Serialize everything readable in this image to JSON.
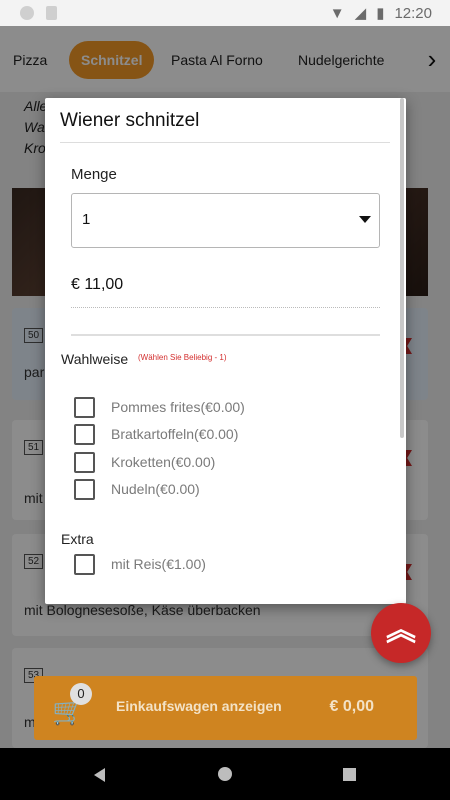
{
  "status_bar": {
    "time": "12:20"
  },
  "categories": {
    "items": [
      "Pizza",
      "Schnitzel",
      "Pasta Al Forno",
      "Nudelgerichte",
      "1"
    ],
    "active": "Schnitzel"
  },
  "background": {
    "top_lines": [
      "Alle",
      "Wa",
      "Kro"
    ],
    "cards": [
      {
        "badge": "50",
        "desc": "par"
      },
      {
        "badge": "51",
        "desc": "mit"
      },
      {
        "badge": "52",
        "desc": "mit Bolognesesoße, Käse überbacken"
      },
      {
        "badge": "53",
        "desc": "m"
      }
    ]
  },
  "dialog": {
    "title": "Wiener schnitzel",
    "quantity_label": "Menge",
    "quantity_value": "1",
    "price": "€ 11,00",
    "options_label": "Wahlweise",
    "options_note": "(Wählen Sie Beliebig - 1)",
    "options": [
      "Pommes frites(€0.00)",
      "Bratkartoffeln(€0.00)",
      "Kroketten(€0.00)",
      "Nudeln(€0.00)"
    ],
    "extra_label": "Extra",
    "extras": [
      "mit Reis(€1.00)"
    ]
  },
  "cart": {
    "count": "0",
    "label": "Einkaufswagen anzeigen",
    "total": "€ 0,00"
  },
  "colors": {
    "accent": "#f59a27",
    "fab": "#c62828",
    "cart_bg": "#cf8420"
  }
}
